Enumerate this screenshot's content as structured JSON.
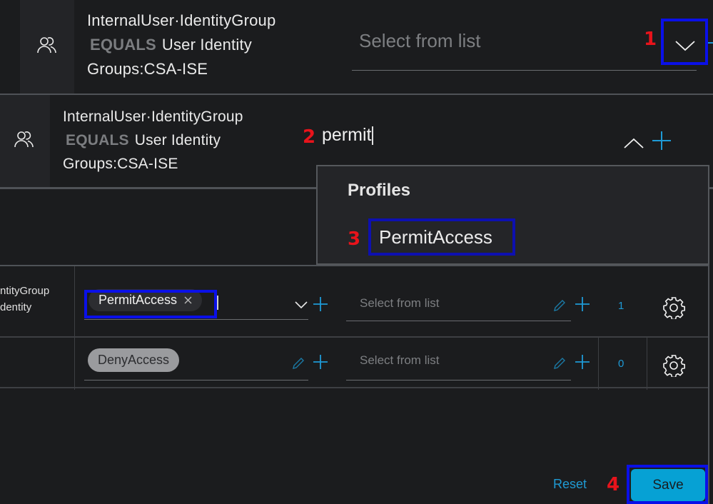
{
  "condition_primary": {
    "attribute": "InternalUser·IdentityGroup",
    "operator": "EQUALS",
    "value_line1": "User Identity",
    "value_line2": "Groups:CSA-ISE",
    "icon": "users-icon"
  },
  "panel1": {
    "select_placeholder": "Select from list",
    "step_label": "1",
    "toggle_icon": "chevron-down-icon"
  },
  "panel2": {
    "step_label": "2",
    "search_value": "permit",
    "toggle_icon": "chevron-up-icon",
    "add_icon": "plus-icon"
  },
  "dropdown": {
    "group_label": "Profiles",
    "step_label": "3",
    "options": [
      "PermitAccess"
    ]
  },
  "rules": [
    {
      "condition_fragment_line1": "ntityGroup",
      "condition_fragment_line2": "dentity",
      "profile": "PermitAccess",
      "profile_removable": true,
      "security_group_placeholder": "Select from list",
      "hits": "1"
    },
    {
      "condition_fragment_line1": "",
      "condition_fragment_line2": "",
      "profile": "DenyAccess",
      "profile_removable": false,
      "security_group_placeholder": "Select from list",
      "hits": "0"
    }
  ],
  "footer": {
    "reset_label": "Reset",
    "save_label": "Save",
    "step_label": "4"
  },
  "colors": {
    "accent": "#06a1d4",
    "link": "#1f9ad3",
    "background": "#1b1c1e",
    "annotation_box": "#0a10e8",
    "annotation_number": "#e8131b"
  }
}
